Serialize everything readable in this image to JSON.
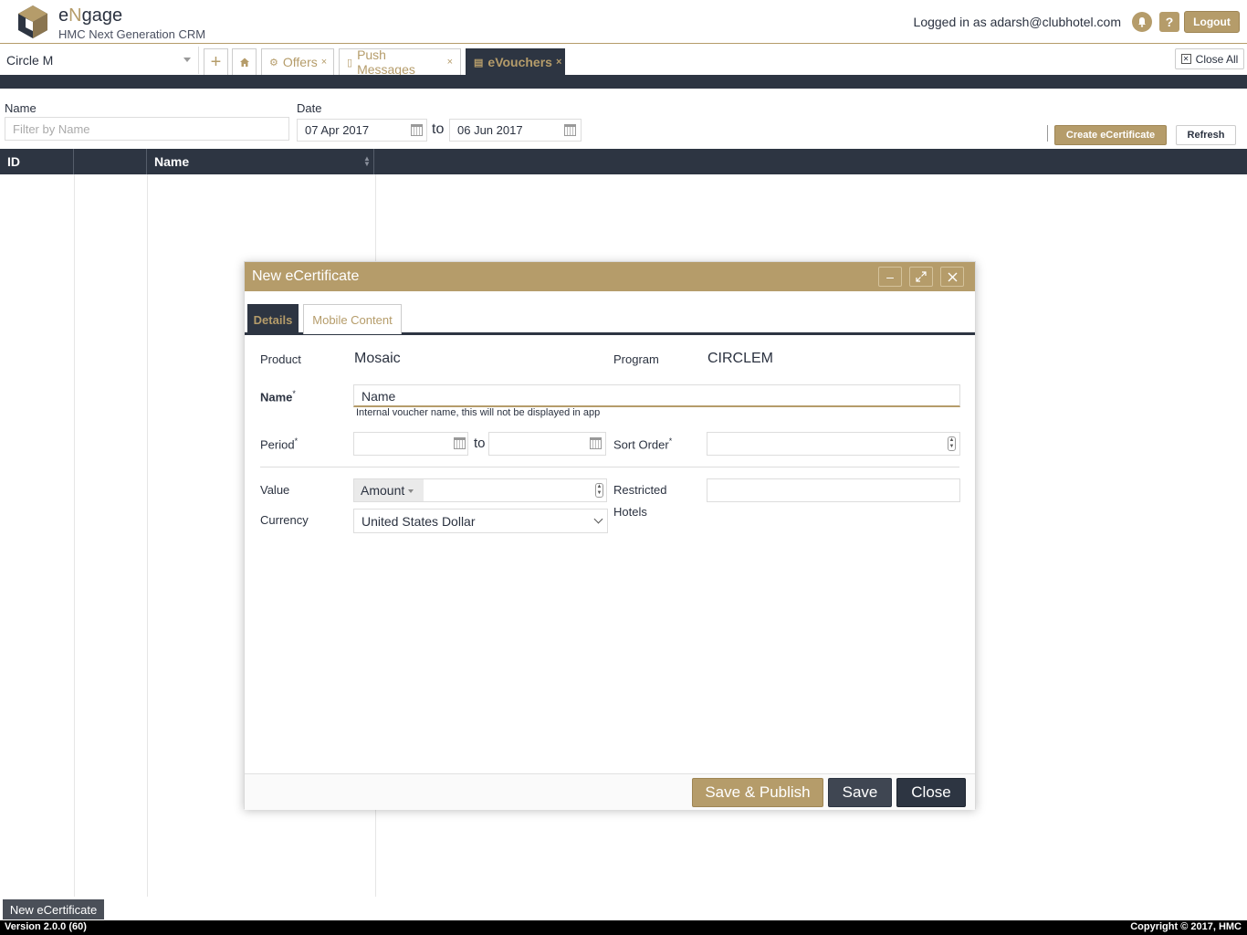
{
  "header": {
    "brand_prefix": "e",
    "brand_n": "N",
    "brand_suffix": "gage",
    "subtitle": "HMC Next Generation CRM",
    "logged_in": "Logged in as adarsh@clubhotel.com",
    "help_glyph": "?",
    "logout_label": "Logout"
  },
  "tabstrip": {
    "circle_value": "Circle M",
    "plus_glyph": "+",
    "tabs": [
      {
        "label": "Offers",
        "icon": "gear-icon",
        "close": "×"
      },
      {
        "label": "Push Messages",
        "icon": "message-icon",
        "close": "×"
      },
      {
        "label": "eVouchers",
        "icon": "voucher-icon",
        "close": "×"
      }
    ],
    "close_all_label": "Close All"
  },
  "filter": {
    "name_label": "Name",
    "name_placeholder": "Filter by Name",
    "date_label": "Date",
    "date_from": "07 Apr 2017",
    "to_label": "to",
    "date_to": "06 Jun 2017",
    "create_label": "Create eCertificate",
    "refresh_label": "Refresh"
  },
  "grid": {
    "columns": [
      "ID",
      "",
      "Name"
    ]
  },
  "dialog": {
    "title": "New eCertificate",
    "tabs": [
      "Details",
      "Mobile Content"
    ],
    "product_label": "Product",
    "product_value": "Mosaic",
    "program_label": "Program",
    "program_value": "CIRCLEM",
    "name_label": "Name",
    "required_mark": "*",
    "name_value": "Name",
    "name_hint": "Internal voucher name, this will not be displayed in app",
    "period_label": "Period",
    "period_to": "to",
    "sort_label": "Sort Order",
    "value_label": "Value",
    "amount_label": "Amount",
    "restricted_label": "Restricted",
    "hotels_label": "Hotels",
    "currency_label": "Currency",
    "currency_value": "United States Dollar",
    "save_publish_label": "Save & Publish",
    "save_label": "Save",
    "close_label": "Close"
  },
  "taskbar": {
    "item_label": "New eCertificate"
  },
  "footer": {
    "version": "Version 2.0.0 (60)",
    "copyright": "Copyright © 2017, HMC"
  },
  "colors": {
    "accent_gold": "#b59c6a",
    "dark_navy": "#2d3542"
  }
}
